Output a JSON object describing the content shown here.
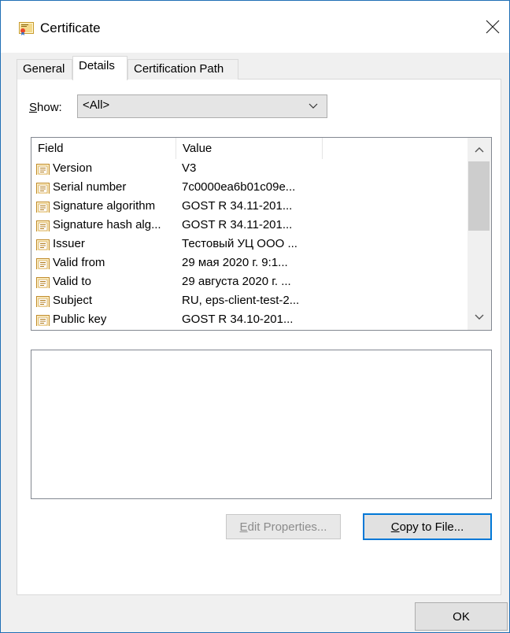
{
  "window": {
    "title": "Certificate"
  },
  "tabs": [
    {
      "label": "General",
      "active": false
    },
    {
      "label": "Details",
      "active": true
    },
    {
      "label": "Certification Path",
      "active": false
    }
  ],
  "show": {
    "label_accel": "S",
    "label_rest": "how:",
    "selected": "<All>"
  },
  "list": {
    "columns": [
      "Field",
      "Value"
    ],
    "rows": [
      {
        "field": "Version",
        "value": "V3"
      },
      {
        "field": "Serial number",
        "value": "7c0000ea6b01c09e..."
      },
      {
        "field": "Signature algorithm",
        "value": "GOST R 34.11-201..."
      },
      {
        "field": "Signature hash alg...",
        "value": "GOST R 34.11-201..."
      },
      {
        "field": "Issuer",
        "value": "Тестовый УЦ ООО ..."
      },
      {
        "field": "Valid from",
        "value": "29 мая 2020 г. 9:1..."
      },
      {
        "field": "Valid to",
        "value": "29 августа 2020 г. ..."
      },
      {
        "field": "Subject",
        "value": "RU, eps-client-test-2..."
      },
      {
        "field": "Public key",
        "value": "GOST R 34.10-201..."
      }
    ]
  },
  "buttons": {
    "edit_accel": "E",
    "edit_rest": "dit Properties...",
    "copy_accel": "C",
    "copy_rest": "opy to File...",
    "ok": "OK"
  },
  "icons": {
    "title": "certificate-icon",
    "field": "field-document-icon",
    "close": "close-icon"
  },
  "colors": {
    "accent": "#0078d7",
    "window_border": "#1f6fb5"
  }
}
